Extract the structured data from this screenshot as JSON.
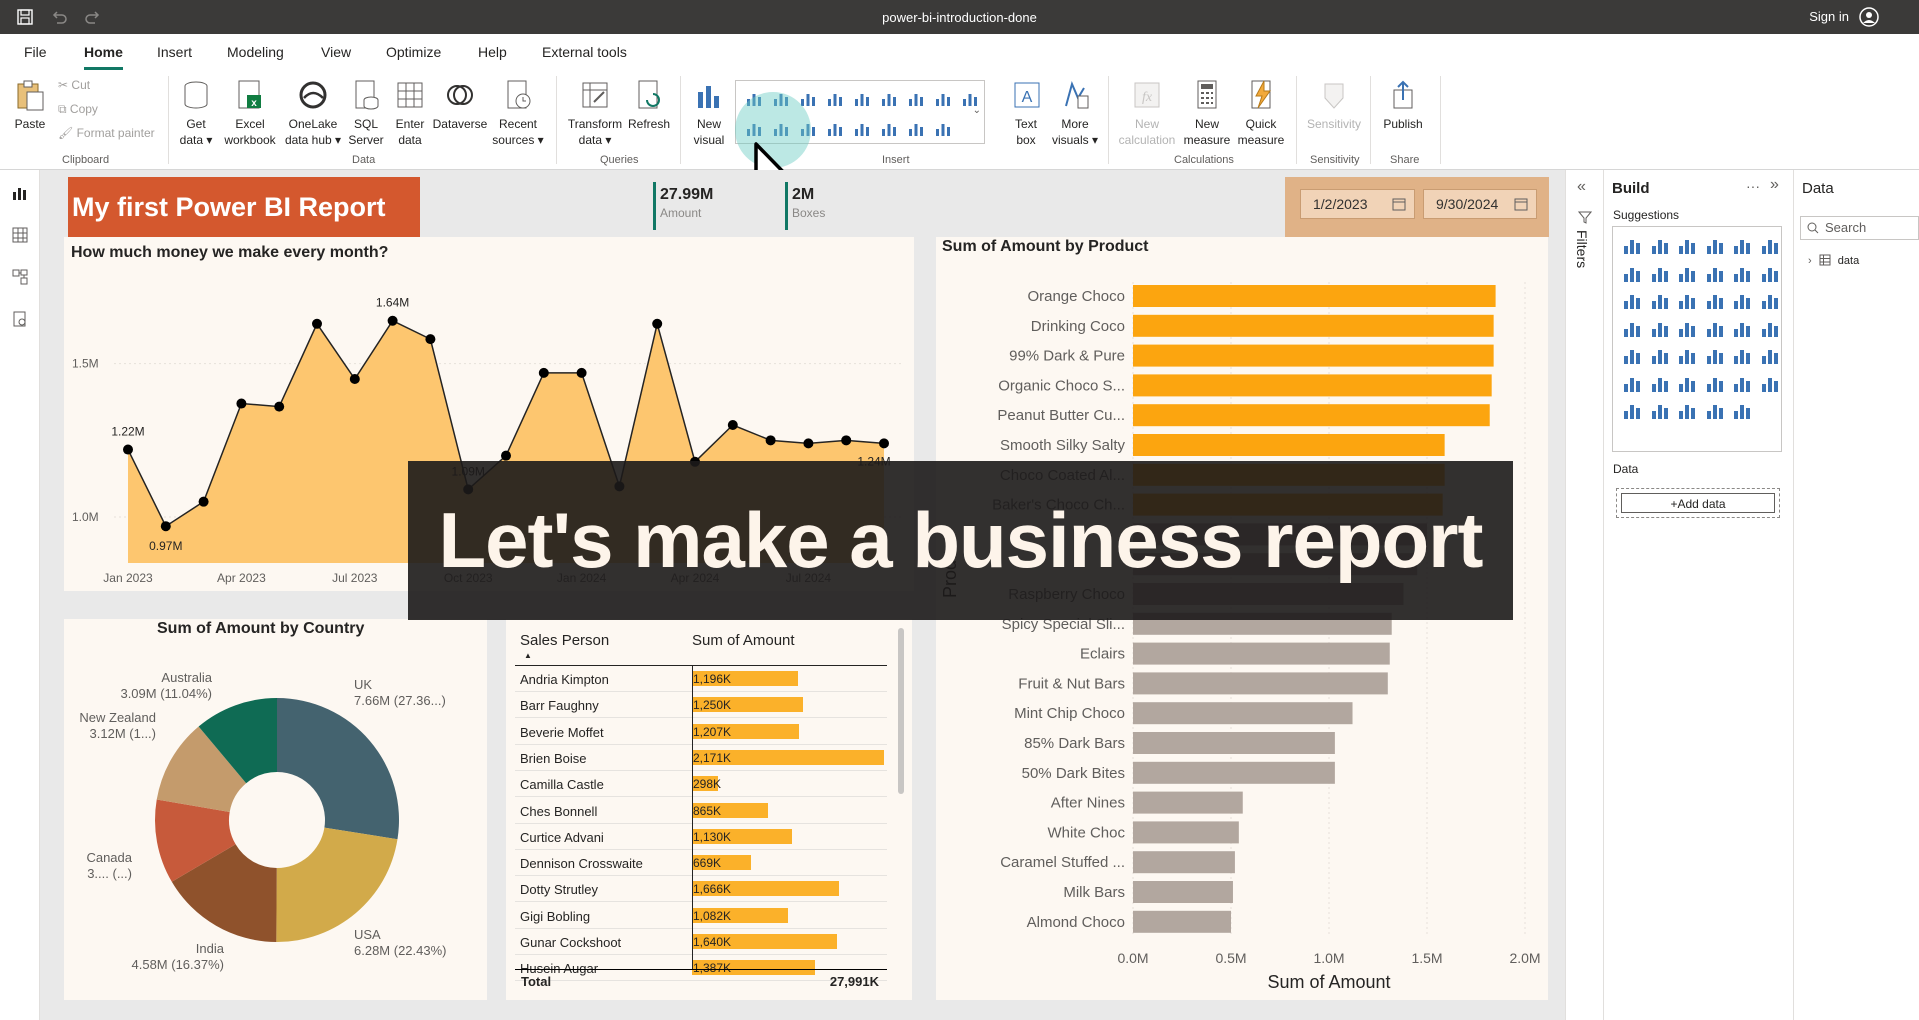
{
  "titlebar": {
    "doc_title": "power-bi-introduction-done",
    "signin": "Sign in"
  },
  "menu": {
    "tabs": [
      "File",
      "Home",
      "Insert",
      "Modeling",
      "View",
      "Optimize",
      "Help",
      "External tools"
    ],
    "active": "Home"
  },
  "ribbon": {
    "paste": "Paste",
    "cut": "Cut",
    "copy": "Copy",
    "format_painter": "Format painter",
    "get_data": "Get data",
    "excel_workbook": "Excel workbook",
    "onelake": "OneLake data hub",
    "sql_server": "SQL Server",
    "enter_data": "Enter data",
    "dataverse": "Dataverse",
    "recent_sources": "Recent sources",
    "transform_data": "Transform data",
    "refresh": "Refresh",
    "new_visual": "New visual",
    "text_box": "Text box",
    "more_visuals": "More visuals",
    "new_calculation": "New calculation",
    "new_measure": "New measure",
    "quick_measure": "Quick measure",
    "sensitivity": "Sensitivity",
    "publish": "Publish",
    "groups": {
      "clipboard": "Clipboard",
      "data": "Data",
      "queries": "Queries",
      "insert": "Insert",
      "calculations": "Calculations",
      "sensitivity": "Sensitivity",
      "share": "Share"
    }
  },
  "report": {
    "title": "My first Power BI Report",
    "kpi_amount_value": "27.99M",
    "kpi_amount_label": "Amount",
    "kpi_boxes_value": "2M",
    "kpi_boxes_label": "Boxes",
    "date_from": "1/2/2023",
    "date_to": "9/30/2024"
  },
  "line_chart_title": "How much money we make every month?",
  "bar_chart_title": "Sum of Amount by Product",
  "donut_chart_title": "Sum of Amount by Country",
  "table": {
    "col_person": "Sales Person",
    "col_amount": "Sum of Amount",
    "rows": [
      {
        "name": "Andria Kimpton",
        "value": "1,196K",
        "v": 1196
      },
      {
        "name": "Barr Faughny",
        "value": "1,250K",
        "v": 1250
      },
      {
        "name": "Beverie Moffet",
        "value": "1,207K",
        "v": 1207
      },
      {
        "name": "Brien Boise",
        "value": "2,171K",
        "v": 2171
      },
      {
        "name": "Camilla Castle",
        "value": "298K",
        "v": 298
      },
      {
        "name": "Ches Bonnell",
        "value": "865K",
        "v": 865
      },
      {
        "name": "Curtice Advani",
        "value": "1,130K",
        "v": 1130
      },
      {
        "name": "Dennison Crosswaite",
        "value": "669K",
        "v": 669
      },
      {
        "name": "Dotty Strutley",
        "value": "1,666K",
        "v": 1666
      },
      {
        "name": "Gigi Bobling",
        "value": "1,082K",
        "v": 1082
      },
      {
        "name": "Gunar Cockshoot",
        "value": "1,640K",
        "v": 1640
      },
      {
        "name": "Husein Augar",
        "value": "1,387K",
        "v": 1387
      }
    ],
    "total_label": "Total",
    "total_value": "27,991K"
  },
  "overlay": {
    "text": "Let's make a business report"
  },
  "panes": {
    "filters": "Filters",
    "build": "Build",
    "suggestions": "Suggestions",
    "data_section": "Data",
    "add_data": "+Add data",
    "data_title": "Data",
    "search_placeholder": "Search",
    "tree_item": "data"
  },
  "chart_data": [
    {
      "type": "area",
      "title": "How much money we make every month?",
      "x": [
        "Jan 2023",
        "Feb 2023",
        "Mar 2023",
        "Apr 2023",
        "May 2023",
        "Jun 2023",
        "Jul 2023",
        "Aug 2023",
        "Sep 2023",
        "Oct 2023",
        "Nov 2023",
        "Dec 2023",
        "Jan 2024",
        "Feb 2024",
        "Mar 2024",
        "Apr 2024",
        "May 2024",
        "Jun 2024",
        "Jul 2024",
        "Aug 2024",
        "Sep 2024"
      ],
      "values": [
        1.22,
        0.97,
        1.05,
        1.37,
        1.36,
        1.63,
        1.45,
        1.64,
        1.58,
        1.09,
        1.2,
        1.47,
        1.47,
        1.1,
        1.63,
        1.18,
        1.3,
        1.25,
        1.24,
        1.25,
        1.24
      ],
      "xtick_labels": [
        "Jan 2023",
        "Apr 2023",
        "Jul 2023",
        "Oct 2023",
        "Jan 2024",
        "Apr 2024",
        "Jul 2024"
      ],
      "ytick_labels": [
        "1.0M",
        "1.5M"
      ],
      "data_labels": {
        "0": "1.22M",
        "1": "0.97M",
        "7": "1.64M",
        "9": "1.09M",
        "20": "1.24M"
      },
      "ylim": [
        0.85,
        1.75
      ],
      "color": "#fdc66f"
    },
    {
      "type": "bar",
      "title": "Sum of Amount by Product",
      "orientation": "horizontal",
      "categories": [
        "Orange Choco",
        "Drinking Coco",
        "99% Dark & Pure",
        "Organic Choco S...",
        "Peanut Butter Cu...",
        "Smooth Silky Salty",
        "Choco Coated Al...",
        "Baker's Choco Ch...",
        "",
        "",
        "Raspberry Choco",
        "Spicy Special Sli...",
        "Eclairs",
        "Fruit & Nut Bars",
        "Mint Chip Choco",
        "85% Dark Bars",
        "50% Dark Bites",
        "After Nines",
        "White Choc",
        "Caramel Stuffed ...",
        "Milk Bars",
        "Almond Choco"
      ],
      "values": [
        1.85,
        1.84,
        1.84,
        1.83,
        1.82,
        1.59,
        1.59,
        1.58,
        1.5,
        1.45,
        1.38,
        1.32,
        1.31,
        1.3,
        1.12,
        1.03,
        1.03,
        0.56,
        0.54,
        0.52,
        0.51,
        0.5
      ],
      "colors": [
        "#fca50f",
        "#fca50f",
        "#fca50f",
        "#fca50f",
        "#fca50f",
        "#fca50f",
        "#fca50f",
        "#fca50f",
        "#b2a79f",
        "#b2a79f",
        "#b2a79f",
        "#b2a79f",
        "#b2a79f",
        "#b2a79f",
        "#b2a79f",
        "#b2a79f",
        "#b2a79f",
        "#b2a79f",
        "#b2a79f",
        "#b2a79f",
        "#b2a79f",
        "#b2a79f"
      ],
      "xlabel": "Sum of Amount",
      "ylabel": "Product",
      "xtick_labels": [
        "0.0M",
        "0.5M",
        "1.0M",
        "1.5M",
        "2.0M"
      ],
      "xlim": [
        0,
        2.0
      ]
    },
    {
      "type": "pie",
      "title": "Sum of Amount by Country",
      "donut": true,
      "slices": [
        {
          "label": "UK",
          "value": 7.66,
          "text": "7.66M (27.36...)",
          "color": "#44636f"
        },
        {
          "label": "USA",
          "value": 6.28,
          "text": "6.28M (22.43%)",
          "color": "#d2aa4a"
        },
        {
          "label": "India",
          "value": 4.58,
          "text": "4.58M (16.37%)",
          "color": "#8f522c"
        },
        {
          "label": "Canada",
          "value": 3.1,
          "text": "3.... (...)",
          "color": "#c75a3b"
        },
        {
          "label": "New Zealand",
          "value": 3.12,
          "text": "3.12M (1...)",
          "color": "#c49b6c"
        },
        {
          "label": "Australia",
          "value": 3.09,
          "text": "3.09M (11.04%)",
          "color": "#0f6b54"
        }
      ]
    }
  ]
}
